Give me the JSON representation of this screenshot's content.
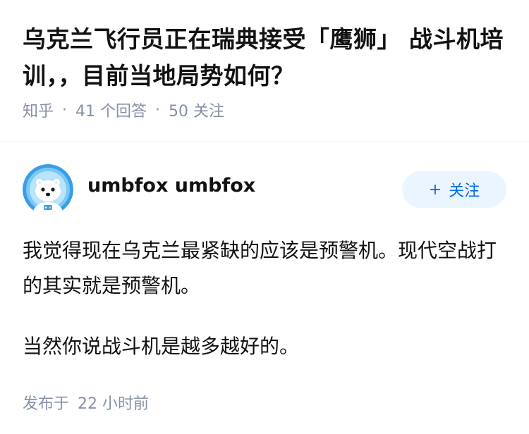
{
  "question": {
    "title": "乌克兰飞行员正在瑞典接受「鹰狮」 战斗机培训，，目前当地局势如何？",
    "source": "知乎",
    "separator": "·",
    "answer_count": "41 个回答",
    "follow_count": "50 关注"
  },
  "answer": {
    "author": {
      "name": "umbfox umbfox",
      "avatar_icon": "polar-bear-astronaut-avatar"
    },
    "follow_button": {
      "icon": "plus-icon",
      "icon_glyph": "+",
      "label": "关注"
    },
    "paragraphs": [
      "我觉得现在乌克兰最紧缺的应该是预警机。现代空战打的其实就是预警机。",
      "当然你说战斗机是越多越好的。"
    ],
    "publish_label": "发布于",
    "publish_time": "22 小时前"
  },
  "colors": {
    "text_primary": "#121212",
    "text_secondary": "#8590a6",
    "accent": "#056de8",
    "button_bg": "#ebf5ff",
    "divider": "#f0f2f7"
  }
}
